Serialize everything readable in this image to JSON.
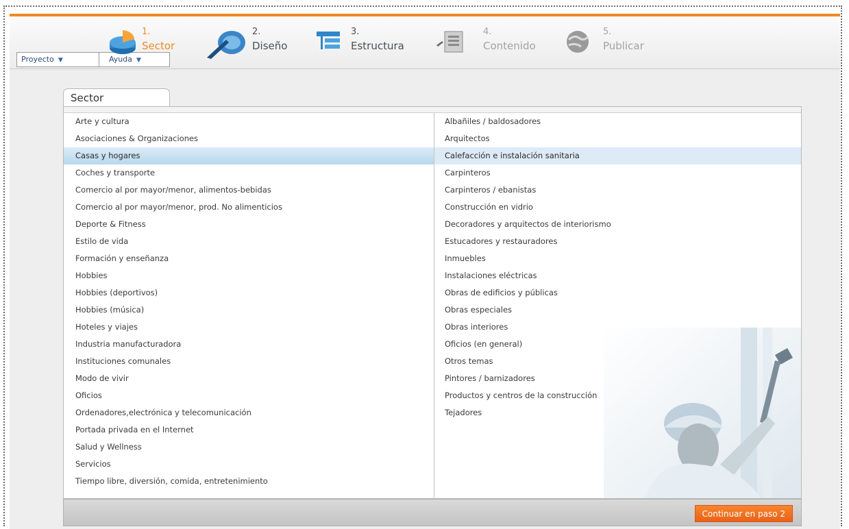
{
  "menus": [
    {
      "label": "Proyecto"
    },
    {
      "label": "Ayuda"
    }
  ],
  "steps": [
    {
      "number": "1.",
      "label": "Sector",
      "state": "active",
      "icon": "pie-chart-icon"
    },
    {
      "number": "2.",
      "label": "Diseño",
      "state": "normal",
      "icon": "palette-brush-icon"
    },
    {
      "number": "3.",
      "label": "Estructura",
      "state": "normal",
      "icon": "structure-tree-icon"
    },
    {
      "number": "4.",
      "label": "Contenido",
      "state": "muted",
      "icon": "document-edit-icon"
    },
    {
      "number": "5.",
      "label": "Publicar",
      "state": "muted",
      "icon": "globe-icon"
    }
  ],
  "tab": {
    "label": "Sector"
  },
  "sectors": [
    "Arte y cultura",
    "Asociaciones & Organizaciones",
    "Casas y hogares",
    "Coches y transporte",
    "Comercio al por mayor/menor, alimentos-bebidas",
    "Comercio al por mayor/menor, prod. No alimenticios",
    "Deporte & Fitness",
    "Estilo de vida",
    "Formación y enseñanza",
    "Hobbies",
    "Hobbies (deportivos)",
    "Hobbies (música)",
    "Hoteles y viajes",
    "Industria manufacturadora",
    "Instituciones comunales",
    "Modo de vivir",
    "Oficios",
    "Ordenadores,electrónica y telecomunicación",
    "Portada privada en el Internet",
    "Salud y Wellness",
    "Servicios",
    "Tiempo libre, diversión, comida, entretenimiento"
  ],
  "selected_sector": "Casas y hogares",
  "subsectors": [
    "Albañiles / baldosadores",
    "Arquitectos",
    "Calefacción e instalación sanitaria",
    "Carpinteros",
    "Carpinteros / ebanistas",
    "Construcción en vidrio",
    "Decoradores y arquitectos de interiorismo",
    "Estucadores y restauradores",
    "Inmuebles",
    "Instalaciones eléctricas",
    "Obras de edificios y públicas",
    "Obras especiales",
    "Obras interiores",
    "Oficios (en general)",
    "Otros temas",
    "Pintores / barnizadores",
    "Productos y centros de la construcción",
    "Tejadores"
  ],
  "selected_subsector": "Calefacción e instalación sanitaria",
  "footer": {
    "continue_label": "Continuar en paso 2"
  },
  "colors": {
    "accent": "#f08a24",
    "selection": "#b7d7ee",
    "button": "#f07a26"
  }
}
